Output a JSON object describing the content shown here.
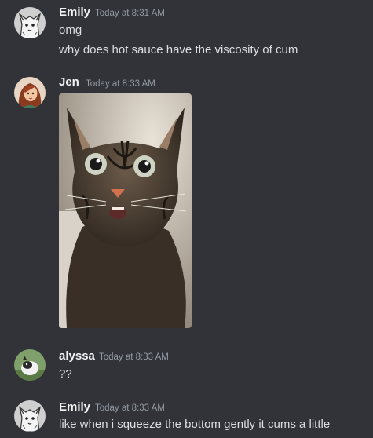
{
  "messages": [
    {
      "author": "Emily",
      "timestamp": "Today at 8:31 AM",
      "avatar_icon": "sketch-animal-avatar",
      "lines": [
        "omg",
        "why does hot sauce have the viscosity of cum"
      ]
    },
    {
      "author": "Jen",
      "timestamp": "Today at 8:33 AM",
      "avatar_icon": "illustrated-person-avatar",
      "attachment": "startled-tabby-cat-photo"
    },
    {
      "author": "alyssa",
      "timestamp": "Today at 8:33 AM",
      "avatar_icon": "animal-photo-avatar",
      "lines": [
        "??"
      ]
    },
    {
      "author": "Emily",
      "timestamp": "Today at 8:33 AM",
      "avatar_icon": "sketch-animal-avatar",
      "lines": [
        "like when i squeeze the bottom gently it cums a little"
      ]
    }
  ],
  "colors": {
    "background": "#313338",
    "username": "#f2f3f5",
    "timestamp": "#949ba4",
    "message_text": "#dbdee1"
  }
}
